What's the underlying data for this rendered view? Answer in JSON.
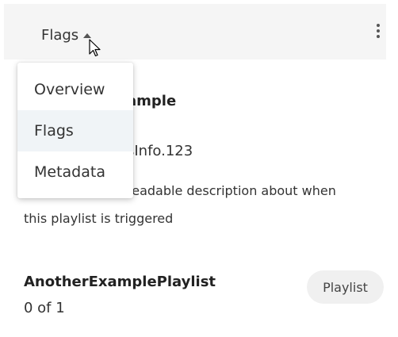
{
  "header": {
    "dropdown_label": "Flags"
  },
  "menu": {
    "items": [
      {
        "label": "Overview"
      },
      {
        "label": "Flags"
      },
      {
        "label": "Metadata"
      }
    ],
    "selected": "Flags"
  },
  "items": [
    {
      "title": "ample",
      "id": "sInfo.123",
      "description_line1": "readable description about when",
      "description_line2": "this playlist is triggered"
    },
    {
      "title": "AnotherExamplePlaylist",
      "count": "0 of 1",
      "badge": "Playlist"
    }
  ],
  "colors": {
    "header_bg": "#f5f5f5",
    "menu_highlight": "#f0f4f7",
    "badge_bg": "#f0f0f0"
  },
  "icons": [
    "caret-up-icon",
    "kebab-menu-icon",
    "mouse-cursor-icon"
  ]
}
